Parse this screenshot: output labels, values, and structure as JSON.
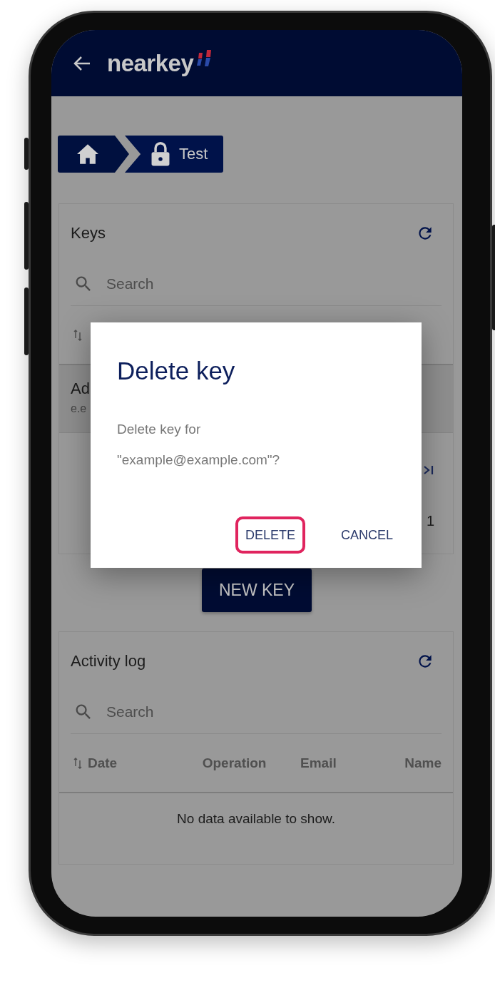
{
  "app_bar": {
    "logo": "nearkey"
  },
  "breadcrumb": {
    "current": "Test"
  },
  "keys_card": {
    "title": "Keys",
    "search": {
      "placeholder": "Search"
    },
    "row": {
      "primary": "Ad",
      "secondary": "e.e"
    },
    "page": "1"
  },
  "new_key_button": "NEW KEY",
  "activity_card": {
    "title": "Activity log",
    "search": {
      "placeholder": "Search"
    },
    "columns": [
      "Date",
      "Operation",
      "Email",
      "Name"
    ],
    "empty_text": "No data available to show."
  },
  "dialog": {
    "title": "Delete key",
    "message": [
      "Delete key for",
      "\"example@example.com\"?"
    ],
    "buttons": [
      {
        "label": "DELETE",
        "highlighted": true
      },
      {
        "label": "CANCEL",
        "highlighted": false
      }
    ]
  }
}
